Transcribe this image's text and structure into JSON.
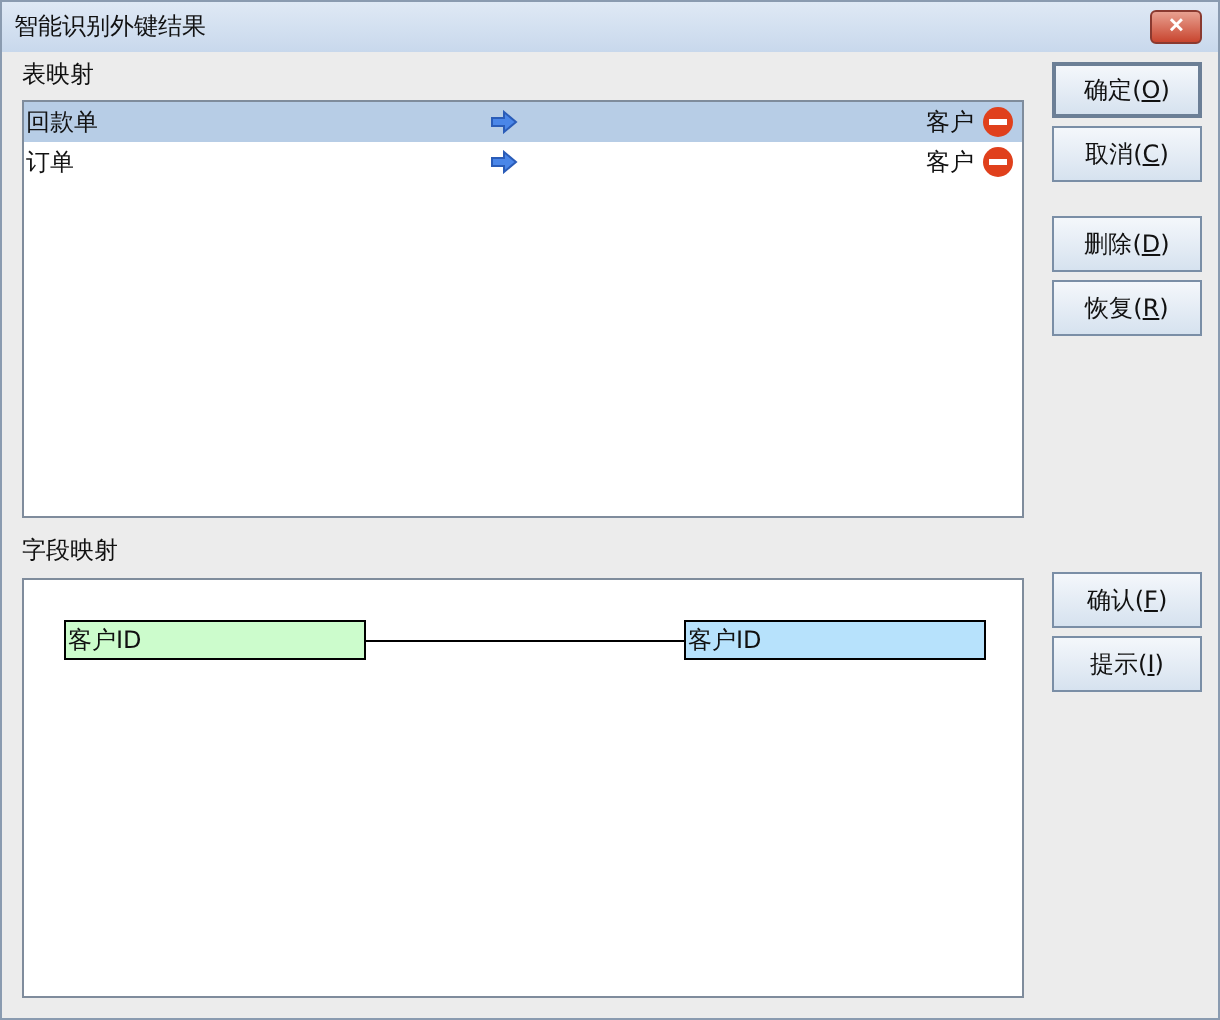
{
  "window": {
    "title": "智能识别外键结果",
    "close": "✕"
  },
  "table_mapping": {
    "label": "表映射",
    "rows": [
      {
        "source": "回款单",
        "target": "客户",
        "selected": true
      },
      {
        "source": "订单",
        "target": "客户",
        "selected": false
      }
    ]
  },
  "field_mapping": {
    "label": "字段映射",
    "source_field": "客户ID",
    "target_field": "客户ID"
  },
  "button_groups": [
    [
      {
        "label": "确定(",
        "key": "O",
        "tail": ")",
        "default": true
      },
      {
        "label": "取消(",
        "key": "C",
        "tail": ")",
        "default": false
      }
    ],
    [
      {
        "label": "删除(",
        "key": "D",
        "tail": ")",
        "default": false
      },
      {
        "label": "恢复(",
        "key": "R",
        "tail": ")",
        "default": false
      }
    ],
    [
      {
        "label": "确认(",
        "key": "F",
        "tail": ")",
        "default": false
      },
      {
        "label": "提示(",
        "key": "I",
        "tail": ")",
        "default": false
      }
    ]
  ]
}
